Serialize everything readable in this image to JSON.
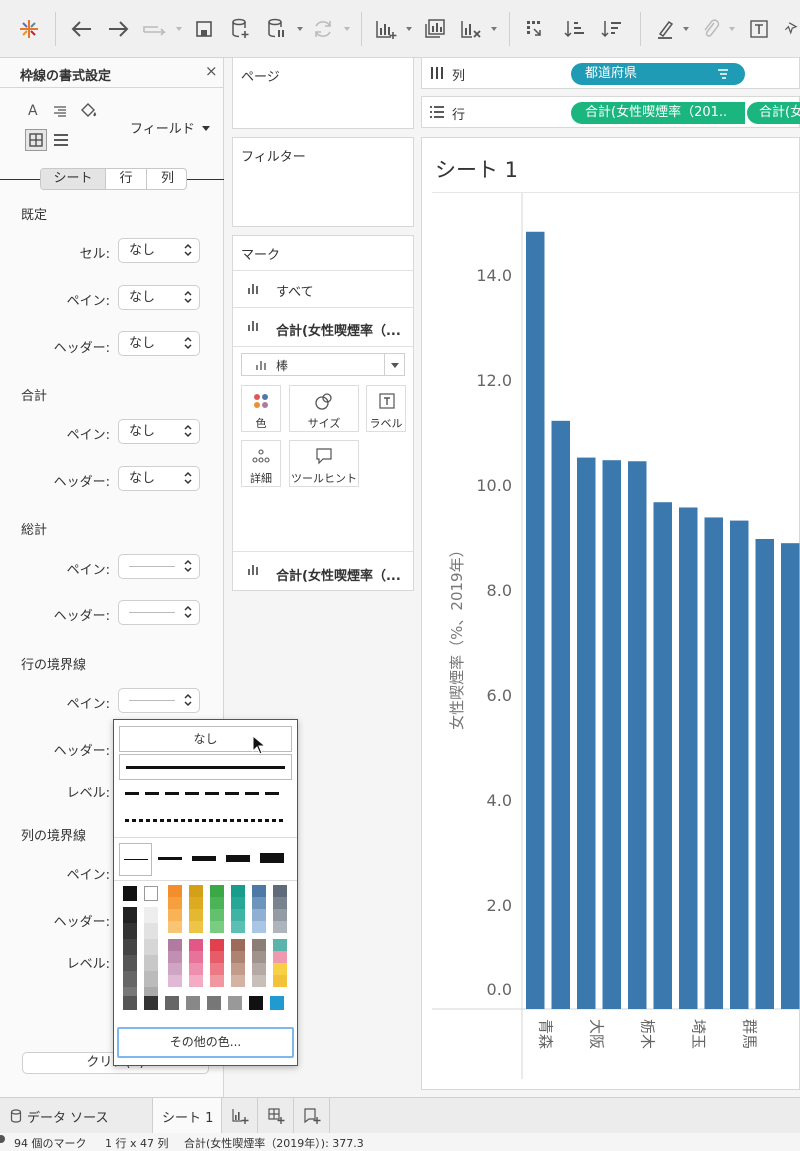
{
  "format_panel": {
    "title": "枠線の書式設定",
    "field_dropdown": "フィールド",
    "tabs": [
      "シート",
      "行",
      "列"
    ],
    "sections": {
      "default": {
        "title": "既定",
        "cell_label": "セル:",
        "cell_value": "なし",
        "pane_label": "ペイン:",
        "pane_value": "なし",
        "header_label": "ヘッダー:",
        "header_value": "なし"
      },
      "total": {
        "title": "合計",
        "pane_label": "ペイン:",
        "pane_value": "なし",
        "header_label": "ヘッダー:",
        "header_value": "なし"
      },
      "grand_total": {
        "title": "総計",
        "pane_label": "ペイン:",
        "header_label": "ヘッダー:"
      },
      "row_divider": {
        "title": "行の境界線",
        "pane_label": "ペイン:",
        "header_label": "ヘッダー:",
        "level_label": "レベル:"
      },
      "column_divider": {
        "title": "列の境界線",
        "pane_label": "ペイン:",
        "header_label": "ヘッダー:",
        "level_label": "レベル:"
      }
    },
    "clear_button": "クリア(C)"
  },
  "cards": {
    "pages": "ページ",
    "filters": "フィルター",
    "marks": {
      "title": "マーク",
      "all": "すべて",
      "measure": "合計(女性喫煙率（...",
      "mark_type": "棒",
      "buttons": {
        "color": "色",
        "size": "サイズ",
        "label": "ラベル",
        "detail": "詳細",
        "tooltip": "ツールヒント"
      },
      "bottom_measure": "合計(女性喫煙率（..."
    }
  },
  "shelves": {
    "columns": {
      "label": "列",
      "pill": "都道府県"
    },
    "rows": {
      "label": "行",
      "pill1": "合計(女性喫煙率（201..",
      "pill2": "合計(女"
    }
  },
  "line_popup": {
    "none_option": "なし",
    "more_colors": "その他の色..."
  },
  "colors": {
    "accent_blue": "#4e79a7",
    "bar": "#3b78ad",
    "pill_dimension": "#1f9bb5",
    "pill_measure": "#1bb580",
    "popup_focus": "#7fb8ee"
  },
  "chart_data": {
    "type": "bar",
    "title": "シート 1",
    "ylabel": "女性喫煙率（%、2019年）",
    "categories": [
      "青森",
      "",
      "大阪",
      "",
      "栃木",
      "",
      "埼玉",
      "",
      "群馬",
      ""
    ],
    "values": [
      14.8,
      11.2,
      10.5,
      10.45,
      10.43,
      9.65,
      9.55,
      9.36,
      9.3,
      8.95,
      8.87
    ],
    "yticks": [
      "14.0",
      "12.0",
      "10.0",
      "8.0",
      "6.0",
      "4.0",
      "2.0",
      "0.0"
    ],
    "ylim": [
      0,
      15.5
    ],
    "grid": false,
    "legend": "none"
  },
  "bottom_bar": {
    "datasource_tab": "データ ソース",
    "sheet_tab": "シート 1",
    "status_marks": "94 個のマーク",
    "status_dims": "1 行 x 47 列",
    "status_sum": "合計(女性喫煙率（2019年）): 377.3"
  }
}
